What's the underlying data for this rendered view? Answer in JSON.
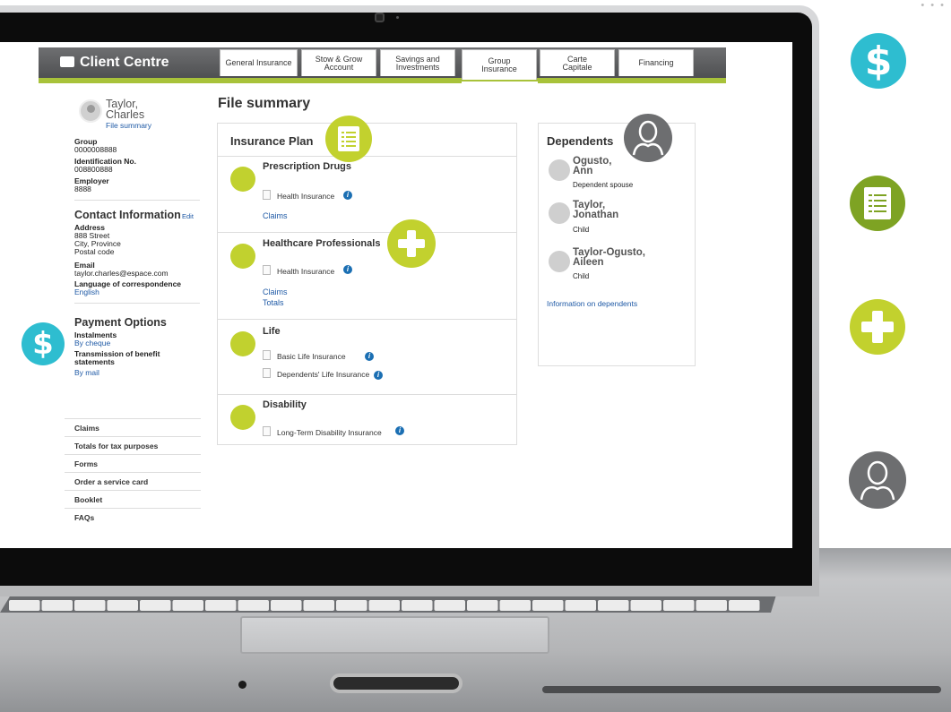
{
  "app": {
    "brand": "Client Centre"
  },
  "tabs": [
    {
      "label": "General Insurance"
    },
    {
      "label": "Stow & Grow\nAccount"
    },
    {
      "label": "Savings and\nInvestments"
    },
    {
      "label": "Group\nInsurance"
    },
    {
      "label": "Carte\nCapitale"
    },
    {
      "label": "Financing"
    }
  ],
  "client": {
    "name": "Taylor,\nCharles",
    "file_summary_link": "File summary",
    "group_label": "Group",
    "group": "0000008888",
    "id_label": "Identification No.",
    "id": "008800888",
    "employer_label": "Employer",
    "employer": "8888"
  },
  "contact": {
    "title": "Contact Information",
    "edit": "Edit",
    "address_label": "Address",
    "address": [
      "888 Street",
      "City, Province",
      "Postal code"
    ],
    "email_label": "Email",
    "email": "taylor.charles@espace.com",
    "language_label": "Language of correspondence",
    "language": "English"
  },
  "payment": {
    "title": "Payment Options",
    "instalments_label": "Instalments",
    "instalments": "By cheque",
    "transmission_label": "Transmission of benefit\nstatements",
    "transmission": "By mail"
  },
  "side_links": [
    "Claims",
    "Totals for tax purposes",
    "Forms",
    "Order a service card",
    "Booklet",
    "FAQs"
  ],
  "main": {
    "title": "File summary",
    "plan_title": "Insurance Plan",
    "sections": [
      {
        "title": "Prescription Drugs",
        "items": [
          "Health Insurance"
        ],
        "links": [
          "Claims"
        ]
      },
      {
        "title": "Healthcare Professionals",
        "items": [
          "Health Insurance"
        ],
        "links": [
          "Claims",
          "Totals"
        ]
      },
      {
        "title": "Life",
        "items": [
          "Basic Life Insurance",
          "Dependents' Life Insurance"
        ],
        "links": []
      },
      {
        "title": "Disability",
        "items": [
          "Long-Term Disability Insurance"
        ],
        "links": []
      }
    ]
  },
  "dependents": {
    "title": "Dependents",
    "people": [
      {
        "name": "Ogusto,\nAnn",
        "relation": "Dependent spouse"
      },
      {
        "name": "Taylor,\nJonathan",
        "relation": "Child"
      },
      {
        "name": "Taylor-Ogusto,\nAileen",
        "relation": "Child"
      }
    ],
    "link": "Information on dependents"
  },
  "colors": {
    "accent_green": "#a8c23a",
    "lime": "#c2d12e",
    "teal": "#2ebdd0",
    "dark_green": "#7ea323",
    "gray": "#6d6e70",
    "link": "#1f5aa6"
  },
  "icons": {
    "dollar": "$",
    "float_icons": [
      "dollar-icon",
      "document-list-icon",
      "plus-icon",
      "person-icon"
    ]
  }
}
